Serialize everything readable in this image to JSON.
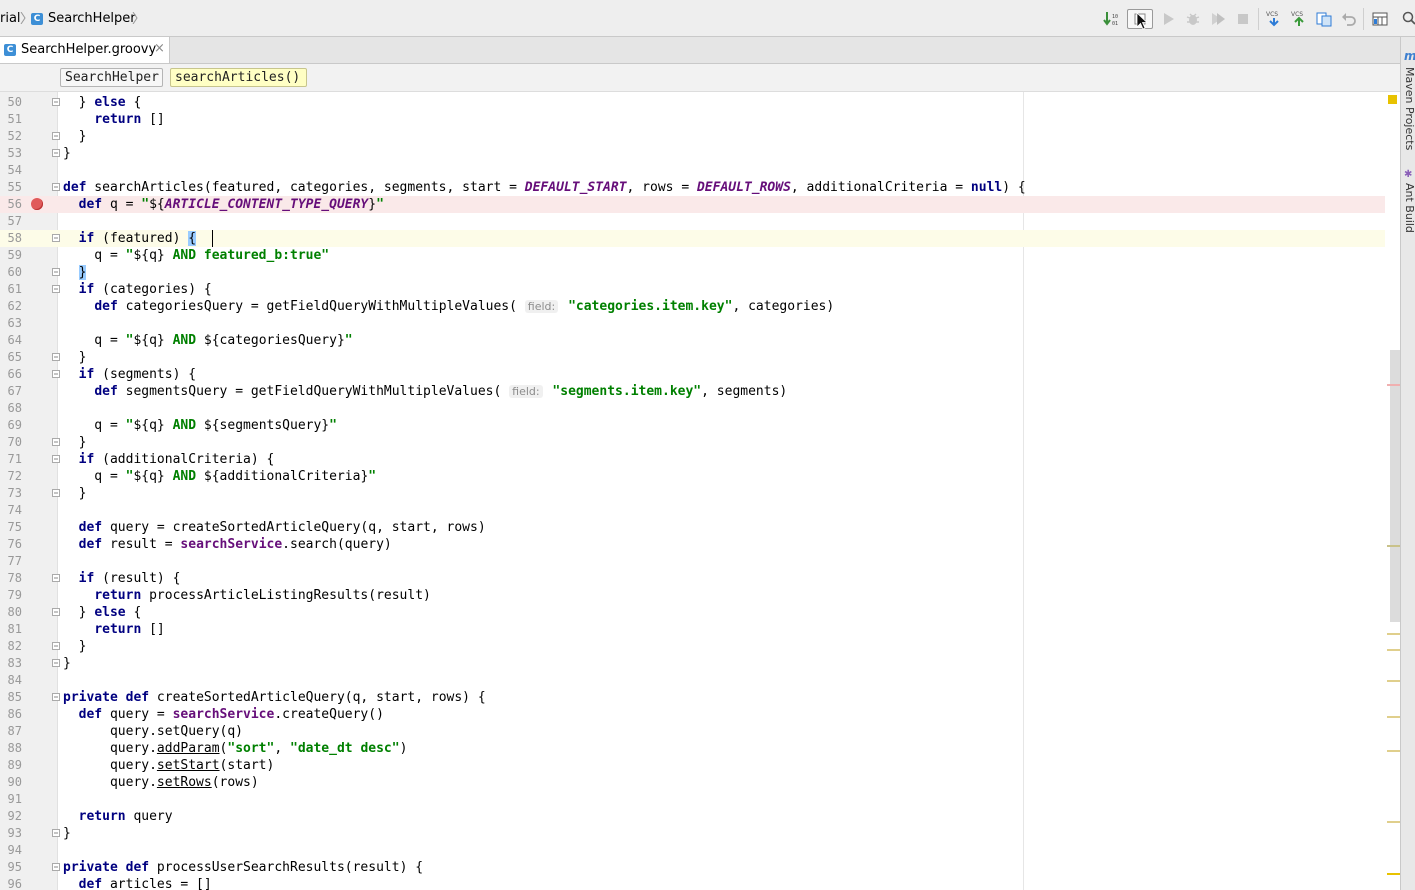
{
  "breadcrumbs": {
    "parent_fragment": "rial",
    "class_name": "SearchHelper",
    "class_icon_letter": "C"
  },
  "tab": {
    "label": "SearchHelper.groovy",
    "close_glyph": "×"
  },
  "structure_path": {
    "class": "SearchHelper",
    "method": "searchArticles()"
  },
  "toolbar": {
    "vcs_label": "VCS"
  },
  "right_tool_windows": [
    "Maven Projects",
    "Ant Build"
  ],
  "maven_icon_glyph": "m",
  "colors": {
    "keyword": "#000080",
    "string": "#008000",
    "constant": "#660e7a",
    "breakpoint": "#e05a5a",
    "breakpoint_line_bg": "#fae9e9",
    "caret_line_bg": "#fdfce8",
    "brace_match": "#99ccff"
  },
  "editor": {
    "lines": [
      {
        "n": "50",
        "t": "  } else {"
      },
      {
        "n": "51",
        "t": "    return []"
      },
      {
        "n": "52",
        "t": "  }"
      },
      {
        "n": "53",
        "t": "}"
      },
      {
        "n": "54",
        "t": ""
      },
      {
        "n": "55",
        "t": "def searchArticles(featured, categories, segments, start = DEFAULT_START, rows = DEFAULT_ROWS, additionalCriteria = null) {"
      },
      {
        "n": "56",
        "t": "  def q = \"${ARTICLE_CONTENT_TYPE_QUERY}\""
      },
      {
        "n": "57",
        "t": ""
      },
      {
        "n": "58",
        "t": "  if (featured) {"
      },
      {
        "n": "59",
        "t": "    q = \"${q} AND featured_b:true\""
      },
      {
        "n": "60",
        "t": "  }"
      },
      {
        "n": "61",
        "t": "  if (categories) {"
      },
      {
        "n": "62",
        "t": "    def categoriesQuery = getFieldQueryWithMultipleValues( field: \"categories.item.key\", categories)"
      },
      {
        "n": "63",
        "t": ""
      },
      {
        "n": "64",
        "t": "    q = \"${q} AND ${categoriesQuery}\""
      },
      {
        "n": "65",
        "t": "  }"
      },
      {
        "n": "66",
        "t": "  if (segments) {"
      },
      {
        "n": "67",
        "t": "    def segmentsQuery = getFieldQueryWithMultipleValues( field: \"segments.item.key\", segments)"
      },
      {
        "n": "68",
        "t": ""
      },
      {
        "n": "69",
        "t": "    q = \"${q} AND ${segmentsQuery}\""
      },
      {
        "n": "70",
        "t": "  }"
      },
      {
        "n": "71",
        "t": "  if (additionalCriteria) {"
      },
      {
        "n": "72",
        "t": "    q = \"${q} AND ${additionalCriteria}\""
      },
      {
        "n": "73",
        "t": "  }"
      },
      {
        "n": "74",
        "t": ""
      },
      {
        "n": "75",
        "t": "  def query = createSortedArticleQuery(q, start, rows)"
      },
      {
        "n": "76",
        "t": "  def result = searchService.search(query)"
      },
      {
        "n": "77",
        "t": ""
      },
      {
        "n": "78",
        "t": "  if (result) {"
      },
      {
        "n": "79",
        "t": "    return processArticleListingResults(result)"
      },
      {
        "n": "80",
        "t": "  } else {"
      },
      {
        "n": "81",
        "t": "    return []"
      },
      {
        "n": "82",
        "t": "  }"
      },
      {
        "n": "83",
        "t": "}"
      },
      {
        "n": "84",
        "t": ""
      },
      {
        "n": "85",
        "t": "private def createSortedArticleQuery(q, start, rows) {"
      },
      {
        "n": "86",
        "t": "  def query = searchService.createQuery()"
      },
      {
        "n": "87",
        "t": "      query.setQuery(q)"
      },
      {
        "n": "88",
        "t": "      query.addParam(\"sort\", \"date_dt desc\")"
      },
      {
        "n": "89",
        "t": "      query.setStart(start)"
      },
      {
        "n": "90",
        "t": "      query.setRows(rows)"
      },
      {
        "n": "91",
        "t": ""
      },
      {
        "n": "92",
        "t": "  return query"
      },
      {
        "n": "93",
        "t": "}"
      },
      {
        "n": "94",
        "t": ""
      },
      {
        "n": "95",
        "t": "private def processUserSearchResults(result) {"
      },
      {
        "n": "96",
        "t": "  def articles = []"
      }
    ],
    "breakpoint_line": "56",
    "caret_line": "58"
  }
}
